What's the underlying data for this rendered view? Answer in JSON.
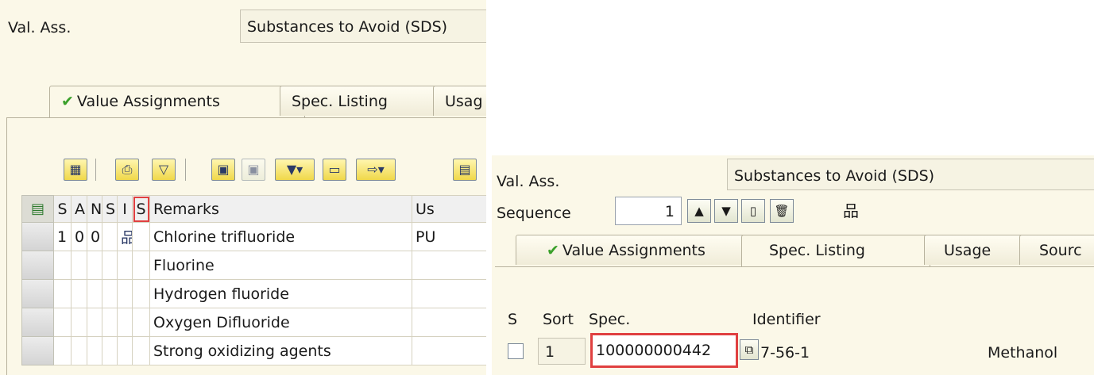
{
  "left": {
    "val_ass_label": "Val. Ass.",
    "val_ass_value": "Substances to Avoid (SDS)",
    "tabs": [
      "Value Assignments",
      "Spec. Listing",
      "Usag"
    ],
    "toolbar_icons": [
      "details-icon",
      "print-icon",
      "filter-funnel-icon",
      "find-icon",
      "find-next-icon",
      "set-filter-icon",
      "print-preview-icon",
      "export-icon",
      "layout-icon"
    ],
    "columns": [
      "S",
      "A",
      "N",
      "S",
      "I",
      "S",
      "Remarks",
      "Us"
    ],
    "first_row": {
      "s": "1",
      "a": "0",
      "n": "0",
      "remark": "Chlorine trifluoride",
      "usage": "PU"
    },
    "remarks": [
      "Chlorine trifluoride",
      "Fluorine",
      "Hydrogen fluoride",
      "Oxygen Difluoride",
      "Strong oxidizing agents"
    ]
  },
  "right": {
    "val_ass_label": "Val. Ass.",
    "val_ass_value": "Substances to Avoid (SDS)",
    "sequence_label": "Sequence",
    "sequence_value": "1",
    "tabs": [
      "Value Assignments",
      "Spec. Listing",
      "Usage",
      "Sourc"
    ],
    "headers": {
      "s": "S",
      "sort": "Sort",
      "spec": "Spec.",
      "identifier": "Identifier"
    },
    "row": {
      "sort": "1",
      "spec": "100000000442",
      "identifier": "7-56-1",
      "name": "Methanol"
    }
  }
}
